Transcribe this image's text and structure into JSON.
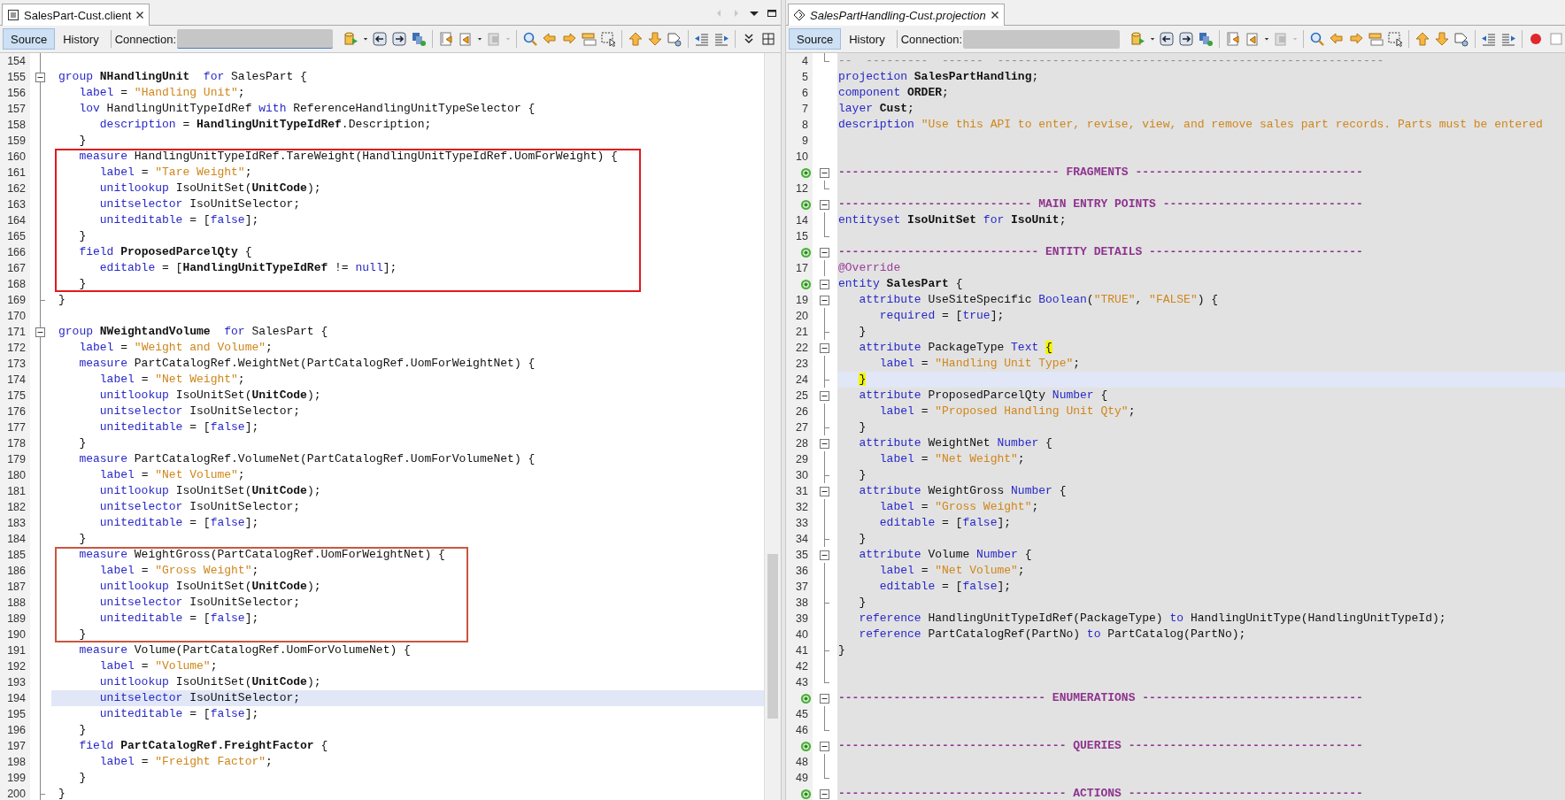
{
  "editors": [
    {
      "kind": "client",
      "tab": {
        "title": "SalesPart-Cust.client"
      },
      "toolbar": {
        "views": [
          {
            "label": "Source",
            "selected": true
          },
          {
            "label": "History",
            "selected": false
          }
        ],
        "connection_label": "Connection:"
      },
      "lines": [
        {
          "no": "154",
          "kind": "none",
          "current": false
        },
        {
          "no": "155",
          "kind": "open",
          "current": false,
          "code": [
            {
              "kind": "kw",
              "text": "group "
            },
            {
              "kind": "b",
              "text": "NHandlingUnit"
            },
            {
              "kind": "kw",
              "text": "  for"
            },
            {
              "kind": "p",
              "text": " SalesPart {"
            }
          ]
        },
        {
          "no": "156",
          "kind": "none",
          "current": false,
          "code": [
            {
              "kind": "kw",
              "text": "   label"
            },
            {
              "kind": "p",
              "text": " = "
            },
            {
              "kind": "str",
              "text": "\"Handling Unit\""
            },
            {
              "kind": "p",
              "text": ";"
            }
          ]
        },
        {
          "no": "157",
          "kind": "none",
          "current": false,
          "code": [
            {
              "kind": "kw",
              "text": "   lov"
            },
            {
              "kind": "p",
              "text": " HandlingUnitTypeIdRef "
            },
            {
              "kind": "kw",
              "text": "with"
            },
            {
              "kind": "p",
              "text": " ReferenceHandlingUnitTypeSelector {"
            }
          ]
        },
        {
          "no": "158",
          "kind": "none",
          "current": false,
          "code": [
            {
              "kind": "kw",
              "text": "      description"
            },
            {
              "kind": "p",
              "text": " = "
            },
            {
              "kind": "b",
              "text": "HandlingUnitTypeIdRef"
            },
            {
              "kind": "p",
              "text": ".Description;"
            }
          ]
        },
        {
          "no": "159",
          "kind": "none",
          "current": false,
          "code": [
            {
              "kind": "p",
              "text": "   }"
            }
          ]
        },
        {
          "kind": "box",
          "color": "#e01b1b",
          "lines": [
            {
              "no": "160",
              "current": false,
              "code": [
                {
                  "kind": "kw",
                  "text": "   measure"
                },
                {
                  "kind": "p",
                  "text": " HandlingUnitTypeIdRef.TareWeight(HandlingUnitTypeIdRef.UomForWeight) {"
                }
              ]
            },
            {
              "no": "161",
              "current": false,
              "code": [
                {
                  "kind": "kw",
                  "text": "      label"
                },
                {
                  "kind": "p",
                  "text": " = "
                },
                {
                  "kind": "str",
                  "text": "\"Tare Weight\""
                },
                {
                  "kind": "p",
                  "text": ";"
                }
              ]
            },
            {
              "no": "162",
              "current": false,
              "code": [
                {
                  "kind": "kw",
                  "text": "      unitlookup"
                },
                {
                  "kind": "p",
                  "text": " IsoUnitSet("
                },
                {
                  "kind": "b",
                  "text": "UnitCode"
                },
                {
                  "kind": "p",
                  "text": ");"
                }
              ]
            },
            {
              "no": "163",
              "current": false,
              "code": [
                {
                  "kind": "kw",
                  "text": "      unitselector"
                },
                {
                  "kind": "p",
                  "text": " IsoUnitSelector;"
                }
              ]
            },
            {
              "no": "164",
              "current": false,
              "code": [
                {
                  "kind": "kw",
                  "text": "      uniteditable"
                },
                {
                  "kind": "p",
                  "text": " = ["
                },
                {
                  "kind": "kw",
                  "text": "false"
                },
                {
                  "kind": "p",
                  "text": "];"
                }
              ]
            },
            {
              "no": "165",
              "current": false,
              "code": [
                {
                  "kind": "p",
                  "text": "   }"
                }
              ]
            },
            {
              "no": "166",
              "current": false,
              "code": [
                {
                  "kind": "kw",
                  "text": "   field"
                },
                {
                  "kind": "b",
                  "text": " ProposedParcelQty"
                },
                {
                  "kind": "p",
                  "text": " {"
                }
              ]
            },
            {
              "no": "167",
              "current": false,
              "code": [
                {
                  "kind": "kw",
                  "text": "      editable"
                },
                {
                  "kind": "p",
                  "text": " = ["
                },
                {
                  "kind": "b",
                  "text": "HandlingUnitTypeIdRef"
                },
                {
                  "kind": "p",
                  "text": " != "
                },
                {
                  "kind": "kw",
                  "text": "null"
                },
                {
                  "kind": "p",
                  "text": "];"
                }
              ]
            },
            {
              "no": "168",
              "current": false,
              "code": [
                {
                  "kind": "p",
                  "text": "   }"
                }
              ]
            }
          ]
        },
        {
          "no": "169",
          "kind": "end",
          "current": false,
          "code": [
            {
              "kind": "p",
              "text": "}"
            }
          ]
        },
        {
          "no": "170",
          "kind": "none",
          "current": false
        },
        {
          "no": "171",
          "kind": "open",
          "current": false,
          "code": [
            {
              "kind": "kw",
              "text": "group "
            },
            {
              "kind": "b",
              "text": "NWeightandVolume"
            },
            {
              "kind": "kw",
              "text": "  for"
            },
            {
              "kind": "p",
              "text": " SalesPart {"
            }
          ]
        },
        {
          "no": "172",
          "kind": "none",
          "current": false,
          "code": [
            {
              "kind": "kw",
              "text": "   label"
            },
            {
              "kind": "p",
              "text": " = "
            },
            {
              "kind": "str",
              "text": "\"Weight and Volume\""
            },
            {
              "kind": "p",
              "text": ";"
            }
          ]
        },
        {
          "no": "173",
          "kind": "none",
          "current": false,
          "code": [
            {
              "kind": "kw",
              "text": "   measure"
            },
            {
              "kind": "p",
              "text": " PartCatalogRef.WeightNet(PartCatalogRef.UomForWeightNet) {"
            }
          ]
        },
        {
          "no": "174",
          "kind": "none",
          "current": false,
          "code": [
            {
              "kind": "kw",
              "text": "      label"
            },
            {
              "kind": "p",
              "text": " = "
            },
            {
              "kind": "str",
              "text": "\"Net Weight\""
            },
            {
              "kind": "p",
              "text": ";"
            }
          ]
        },
        {
          "no": "175",
          "kind": "none",
          "current": false,
          "code": [
            {
              "kind": "kw",
              "text": "      unitlookup"
            },
            {
              "kind": "p",
              "text": " IsoUnitSet("
            },
            {
              "kind": "b",
              "text": "UnitCode"
            },
            {
              "kind": "p",
              "text": ");"
            }
          ]
        },
        {
          "no": "176",
          "kind": "none",
          "current": false,
          "code": [
            {
              "kind": "kw",
              "text": "      unitselector"
            },
            {
              "kind": "p",
              "text": " IsoUnitSelector;"
            }
          ]
        },
        {
          "no": "177",
          "kind": "none",
          "current": false,
          "code": [
            {
              "kind": "kw",
              "text": "      uniteditable"
            },
            {
              "kind": "p",
              "text": " = ["
            },
            {
              "kind": "kw",
              "text": "false"
            },
            {
              "kind": "p",
              "text": "];"
            }
          ]
        },
        {
          "no": "178",
          "kind": "none",
          "current": false,
          "code": [
            {
              "kind": "p",
              "text": "   }"
            }
          ]
        },
        {
          "no": "179",
          "kind": "none",
          "current": false,
          "code": [
            {
              "kind": "kw",
              "text": "   measure"
            },
            {
              "kind": "p",
              "text": " PartCatalogRef.VolumeNet(PartCatalogRef.UomForVolumeNet) {"
            }
          ]
        },
        {
          "no": "180",
          "kind": "none",
          "current": false,
          "code": [
            {
              "kind": "kw",
              "text": "      label"
            },
            {
              "kind": "p",
              "text": " = "
            },
            {
              "kind": "str",
              "text": "\"Net Volume\""
            },
            {
              "kind": "p",
              "text": ";"
            }
          ]
        },
        {
          "no": "181",
          "kind": "none",
          "current": false,
          "code": [
            {
              "kind": "kw",
              "text": "      unitlookup"
            },
            {
              "kind": "p",
              "text": " IsoUnitSet("
            },
            {
              "kind": "b",
              "text": "UnitCode"
            },
            {
              "kind": "p",
              "text": ");"
            }
          ]
        },
        {
          "no": "182",
          "kind": "none",
          "current": false,
          "code": [
            {
              "kind": "kw",
              "text": "      unitselector"
            },
            {
              "kind": "p",
              "text": " IsoUnitSelector;"
            }
          ]
        },
        {
          "no": "183",
          "kind": "none",
          "current": false,
          "code": [
            {
              "kind": "kw",
              "text": "      uniteditable"
            },
            {
              "kind": "p",
              "text": " = ["
            },
            {
              "kind": "kw",
              "text": "false"
            },
            {
              "kind": "p",
              "text": "];"
            }
          ]
        },
        {
          "no": "184",
          "kind": "none",
          "current": false,
          "code": [
            {
              "kind": "p",
              "text": "   }"
            }
          ]
        },
        {
          "kind": "box",
          "color": "#c9573f",
          "lines": [
            {
              "no": "185",
              "current": false,
              "code": [
                {
                  "kind": "kw",
                  "text": "   measure"
                },
                {
                  "kind": "p",
                  "text": " WeightGross(PartCatalogRef.UomForWeightNet) {"
                }
              ]
            },
            {
              "no": "186",
              "current": false,
              "code": [
                {
                  "kind": "kw",
                  "text": "      label"
                },
                {
                  "kind": "p",
                  "text": " = "
                },
                {
                  "kind": "str",
                  "text": "\"Gross Weight\""
                },
                {
                  "kind": "p",
                  "text": ";"
                }
              ]
            },
            {
              "no": "187",
              "current": false,
              "code": [
                {
                  "kind": "kw",
                  "text": "      unitlookup"
                },
                {
                  "kind": "p",
                  "text": " IsoUnitSet("
                },
                {
                  "kind": "b",
                  "text": "UnitCode"
                },
                {
                  "kind": "p",
                  "text": ");"
                }
              ]
            },
            {
              "no": "188",
              "current": false,
              "code": [
                {
                  "kind": "kw",
                  "text": "      unitselector"
                },
                {
                  "kind": "p",
                  "text": " IsoUnitSelector;"
                }
              ]
            },
            {
              "no": "189",
              "current": false,
              "code": [
                {
                  "kind": "kw",
                  "text": "      uniteditable"
                },
                {
                  "kind": "p",
                  "text": " = ["
                },
                {
                  "kind": "kw",
                  "text": "false"
                },
                {
                  "kind": "p",
                  "text": "];"
                }
              ]
            },
            {
              "no": "190",
              "current": false,
              "code": [
                {
                  "kind": "p",
                  "text": "   }"
                }
              ]
            }
          ]
        },
        {
          "no": "191",
          "kind": "none",
          "current": false,
          "code": [
            {
              "kind": "kw",
              "text": "   measure"
            },
            {
              "kind": "p",
              "text": " Volume(PartCatalogRef.UomForVolumeNet) {"
            }
          ]
        },
        {
          "no": "192",
          "kind": "none",
          "current": false,
          "code": [
            {
              "kind": "kw",
              "text": "      label"
            },
            {
              "kind": "p",
              "text": " = "
            },
            {
              "kind": "str",
              "text": "\"Volume\""
            },
            {
              "kind": "p",
              "text": ";"
            }
          ]
        },
        {
          "no": "193",
          "kind": "none",
          "current": false,
          "code": [
            {
              "kind": "kw",
              "text": "      unitlookup"
            },
            {
              "kind": "p",
              "text": " IsoUnitSet("
            },
            {
              "kind": "b",
              "text": "UnitCode"
            },
            {
              "kind": "p",
              "text": ");"
            }
          ]
        },
        {
          "no": "194",
          "kind": "none",
          "current": true,
          "code": [
            {
              "kind": "kw",
              "text": "      unitselector"
            },
            {
              "kind": "p",
              "text": " IsoUnitSelector;"
            }
          ]
        },
        {
          "no": "195",
          "kind": "none",
          "current": false,
          "code": [
            {
              "kind": "kw",
              "text": "      uniteditable"
            },
            {
              "kind": "p",
              "text": " = ["
            },
            {
              "kind": "kw",
              "text": "false"
            },
            {
              "kind": "p",
              "text": "];"
            }
          ]
        },
        {
          "no": "196",
          "kind": "none",
          "current": false,
          "code": [
            {
              "kind": "p",
              "text": "   }"
            }
          ]
        },
        {
          "no": "197",
          "kind": "none",
          "current": false,
          "code": [
            {
              "kind": "kw",
              "text": "   field"
            },
            {
              "kind": "b",
              "text": " PartCatalogRef.FreightFactor"
            },
            {
              "kind": "p",
              "text": " {"
            }
          ]
        },
        {
          "no": "198",
          "kind": "none",
          "current": false,
          "code": [
            {
              "kind": "kw",
              "text": "      label"
            },
            {
              "kind": "p",
              "text": " = "
            },
            {
              "kind": "str",
              "text": "\"Freight Factor\""
            },
            {
              "kind": "p",
              "text": ";"
            }
          ]
        },
        {
          "no": "199",
          "kind": "none",
          "current": false,
          "code": [
            {
              "kind": "p",
              "text": "   }"
            }
          ]
        },
        {
          "no": "200",
          "kind": "end",
          "current": false,
          "code": [
            {
              "kind": "p",
              "text": "}"
            }
          ]
        }
      ]
    },
    {
      "kind": "projection",
      "tab": {
        "title": "SalesPartHandling-Cust.projection"
      },
      "toolbar": {
        "views": [
          {
            "label": "Source",
            "selected": true
          },
          {
            "label": "History",
            "selected": false
          }
        ],
        "connection_label": "Connection:"
      },
      "lines": [
        {
          "no": "4",
          "kind": "end",
          "current": false,
          "marked": false,
          "code": [
            {
              "kind": "cm",
              "text": "--  ---------  ------  --------------------------------------------------------"
            }
          ]
        },
        {
          "no": "5",
          "kind": "none",
          "current": false,
          "marked": false,
          "code": [
            {
              "kind": "kw",
              "text": "projection"
            },
            {
              "kind": "b",
              "text": " SalesPartHandling"
            },
            {
              "kind": "p",
              "text": ";"
            }
          ]
        },
        {
          "no": "6",
          "kind": "none",
          "current": false,
          "marked": false,
          "code": [
            {
              "kind": "kw",
              "text": "component"
            },
            {
              "kind": "b",
              "text": " ORDER"
            },
            {
              "kind": "p",
              "text": ";"
            }
          ]
        },
        {
          "no": "7",
          "kind": "none",
          "current": false,
          "marked": false,
          "code": [
            {
              "kind": "kw",
              "text": "layer"
            },
            {
              "kind": "b",
              "text": " Cust"
            },
            {
              "kind": "p",
              "text": ";"
            }
          ]
        },
        {
          "no": "8",
          "kind": "none",
          "current": false,
          "marked": false,
          "code": [
            {
              "kind": "kw",
              "text": "description"
            },
            {
              "kind": "str",
              "text": " \"Use this API to enter, revise, view, and remove sales part records. Parts must be entered"
            }
          ]
        },
        {
          "no": "9",
          "kind": "none",
          "current": false,
          "marked": false
        },
        {
          "no": "10",
          "kind": "none",
          "current": false,
          "marked": false
        },
        {
          "kind": "open",
          "current": false,
          "marked": true,
          "code": [
            {
              "kind": "sec",
              "text": "-------------------------------- FRAGMENTS ---------------------------------"
            }
          ]
        },
        {
          "no": "12",
          "kind": "end",
          "current": false,
          "marked": false
        },
        {
          "kind": "open",
          "current": false,
          "marked": true,
          "code": [
            {
              "kind": "sec",
              "text": "---------------------------- MAIN ENTRY POINTS -----------------------------"
            }
          ]
        },
        {
          "no": "14",
          "kind": "line",
          "current": false,
          "marked": false,
          "code": [
            {
              "kind": "kw",
              "text": "entityset"
            },
            {
              "kind": "b",
              "text": " IsoUnitSet"
            },
            {
              "kind": "kw",
              "text": " for"
            },
            {
              "kind": "b",
              "text": " IsoUnit"
            },
            {
              "kind": "p",
              "text": ";"
            }
          ]
        },
        {
          "no": "15",
          "kind": "end",
          "current": false,
          "marked": false
        },
        {
          "kind": "open",
          "current": false,
          "marked": true,
          "code": [
            {
              "kind": "sec",
              "text": "----------------------------- ENTITY DETAILS -------------------------------"
            }
          ]
        },
        {
          "no": "17",
          "kind": "line",
          "current": false,
          "marked": false,
          "code": [
            {
              "kind": "ann",
              "text": "@Override"
            }
          ]
        },
        {
          "kind": "open",
          "current": false,
          "marked": true,
          "code": [
            {
              "kind": "kw",
              "text": "entity"
            },
            {
              "kind": "b",
              "text": " SalesPart"
            },
            {
              "kind": "p",
              "text": " {"
            }
          ]
        },
        {
          "no": "19",
          "kind": "open",
          "current": false,
          "marked": false,
          "code": [
            {
              "kind": "kw",
              "text": "   attribute"
            },
            {
              "kind": "p",
              "text": " UseSiteSpecific "
            },
            {
              "kind": "kw",
              "text": "Boolean"
            },
            {
              "kind": "p",
              "text": "("
            },
            {
              "kind": "str",
              "text": "\"TRUE\""
            },
            {
              "kind": "p",
              "text": ", "
            },
            {
              "kind": "str",
              "text": "\"FALSE\""
            },
            {
              "kind": "p",
              "text": ") {"
            }
          ]
        },
        {
          "no": "20",
          "kind": "line",
          "current": false,
          "marked": false,
          "code": [
            {
              "kind": "kw",
              "text": "      required"
            },
            {
              "kind": "p",
              "text": " = ["
            },
            {
              "kind": "kw",
              "text": "true"
            },
            {
              "kind": "p",
              "text": "];"
            }
          ]
        },
        {
          "no": "21",
          "kind": "mid",
          "current": false,
          "marked": false,
          "code": [
            {
              "kind": "p",
              "text": "   }"
            }
          ]
        },
        {
          "no": "22",
          "kind": "open",
          "current": false,
          "marked": false,
          "code": [
            {
              "kind": "kw",
              "text": "   attribute"
            },
            {
              "kind": "p",
              "text": " PackageType "
            },
            {
              "kind": "kw",
              "text": "Text"
            },
            {
              "kind": "match",
              "text": "{"
            }
          ]
        },
        {
          "no": "23",
          "kind": "line",
          "current": false,
          "marked": false,
          "code": [
            {
              "kind": "kw",
              "text": "      label"
            },
            {
              "kind": "p",
              "text": " = "
            },
            {
              "kind": "str",
              "text": "\"Handling Unit Type\""
            },
            {
              "kind": "p",
              "text": ";"
            }
          ]
        },
        {
          "no": "24",
          "kind": "mid",
          "current": true,
          "marked": false,
          "code": [
            {
              "kind": "match",
              "text": "}"
            }
          ]
        },
        {
          "no": "25",
          "kind": "open",
          "current": false,
          "marked": false,
          "code": [
            {
              "kind": "kw",
              "text": "   attribute"
            },
            {
              "kind": "p",
              "text": " ProposedParcelQty "
            },
            {
              "kind": "kw",
              "text": "Number"
            },
            {
              "kind": "p",
              "text": " {"
            }
          ]
        },
        {
          "no": "26",
          "kind": "line",
          "current": false,
          "marked": false,
          "code": [
            {
              "kind": "kw",
              "text": "      label"
            },
            {
              "kind": "p",
              "text": " = "
            },
            {
              "kind": "str",
              "text": "\"Proposed Handling Unit Qty\""
            },
            {
              "kind": "p",
              "text": ";"
            }
          ]
        },
        {
          "no": "27",
          "kind": "mid",
          "current": false,
          "marked": false,
          "code": [
            {
              "kind": "p",
              "text": "   }"
            }
          ]
        },
        {
          "no": "28",
          "kind": "open",
          "current": false,
          "marked": false,
          "code": [
            {
              "kind": "kw",
              "text": "   attribute"
            },
            {
              "kind": "p",
              "text": " WeightNet "
            },
            {
              "kind": "kw",
              "text": "Number"
            },
            {
              "kind": "p",
              "text": " {"
            }
          ]
        },
        {
          "no": "29",
          "kind": "line",
          "current": false,
          "marked": false,
          "code": [
            {
              "kind": "kw",
              "text": "      label"
            },
            {
              "kind": "p",
              "text": " = "
            },
            {
              "kind": "str",
              "text": "\"Net Weight\""
            },
            {
              "kind": "p",
              "text": ";"
            }
          ]
        },
        {
          "no": "30",
          "kind": "mid",
          "current": false,
          "marked": false,
          "code": [
            {
              "kind": "p",
              "text": "   }"
            }
          ]
        },
        {
          "no": "31",
          "kind": "open",
          "current": false,
          "marked": false,
          "code": [
            {
              "kind": "kw",
              "text": "   attribute"
            },
            {
              "kind": "p",
              "text": " WeightGross "
            },
            {
              "kind": "kw",
              "text": "Number"
            },
            {
              "kind": "p",
              "text": " {"
            }
          ]
        },
        {
          "no": "32",
          "kind": "line",
          "current": false,
          "marked": false,
          "code": [
            {
              "kind": "kw",
              "text": "      label"
            },
            {
              "kind": "p",
              "text": " = "
            },
            {
              "kind": "str",
              "text": "\"Gross Weight\""
            },
            {
              "kind": "p",
              "text": ";"
            }
          ]
        },
        {
          "no": "33",
          "kind": "line",
          "current": false,
          "marked": false,
          "code": [
            {
              "kind": "kw",
              "text": "      editable"
            },
            {
              "kind": "p",
              "text": " = ["
            },
            {
              "kind": "kw",
              "text": "false"
            },
            {
              "kind": "p",
              "text": "];"
            }
          ]
        },
        {
          "no": "34",
          "kind": "mid",
          "current": false,
          "marked": false,
          "code": [
            {
              "kind": "p",
              "text": "   }"
            }
          ]
        },
        {
          "no": "35",
          "kind": "open",
          "current": false,
          "marked": false,
          "code": [
            {
              "kind": "kw",
              "text": "   attribute"
            },
            {
              "kind": "p",
              "text": " Volume "
            },
            {
              "kind": "kw",
              "text": "Number"
            },
            {
              "kind": "p",
              "text": " {"
            }
          ]
        },
        {
          "no": "36",
          "kind": "line",
          "current": false,
          "marked": false,
          "code": [
            {
              "kind": "kw",
              "text": "      label"
            },
            {
              "kind": "p",
              "text": " = "
            },
            {
              "kind": "str",
              "text": "\"Net Volume\""
            },
            {
              "kind": "p",
              "text": ";"
            }
          ]
        },
        {
          "no": "37",
          "kind": "line",
          "current": false,
          "marked": false,
          "code": [
            {
              "kind": "kw",
              "text": "      editable"
            },
            {
              "kind": "p",
              "text": " = ["
            },
            {
              "kind": "kw",
              "text": "false"
            },
            {
              "kind": "p",
              "text": "];"
            }
          ]
        },
        {
          "no": "38",
          "kind": "mid",
          "current": false,
          "marked": false,
          "code": [
            {
              "kind": "p",
              "text": "   }"
            }
          ]
        },
        {
          "no": "39",
          "kind": "line",
          "current": false,
          "marked": false,
          "code": [
            {
              "kind": "kw",
              "text": "   reference"
            },
            {
              "kind": "p",
              "text": " HandlingUnitTypeIdRef(PackageType) "
            },
            {
              "kind": "kw",
              "text": "to"
            },
            {
              "kind": "p",
              "text": " HandlingUnitType(HandlingUnitTypeId);"
            }
          ]
        },
        {
          "no": "40",
          "kind": "line",
          "current": false,
          "marked": false,
          "code": [
            {
              "kind": "kw",
              "text": "   reference"
            },
            {
              "kind": "p",
              "text": " PartCatalogRef(PartNo) "
            },
            {
              "kind": "kw",
              "text": "to"
            },
            {
              "kind": "p",
              "text": " PartCatalog(PartNo);"
            }
          ]
        },
        {
          "no": "41",
          "kind": "mid",
          "current": false,
          "marked": false,
          "code": [
            {
              "kind": "p",
              "text": "}"
            }
          ]
        },
        {
          "no": "42",
          "kind": "line",
          "current": false,
          "marked": false
        },
        {
          "no": "43",
          "kind": "end",
          "current": false,
          "marked": false
        },
        {
          "kind": "open",
          "current": false,
          "marked": true,
          "code": [
            {
              "kind": "sec",
              "text": "------------------------------ ENUMERATIONS --------------------------------"
            }
          ]
        },
        {
          "no": "45",
          "kind": "line",
          "current": false,
          "marked": false
        },
        {
          "no": "46",
          "kind": "end",
          "current": false,
          "marked": false
        },
        {
          "kind": "open",
          "current": false,
          "marked": true,
          "code": [
            {
              "kind": "sec",
              "text": "--------------------------------- QUERIES ----------------------------------"
            }
          ]
        },
        {
          "no": "48",
          "kind": "line",
          "current": false,
          "marked": false
        },
        {
          "no": "49",
          "kind": "end",
          "current": false,
          "marked": false
        },
        {
          "kind": "open",
          "current": false,
          "marked": true,
          "code": [
            {
              "kind": "sec",
              "text": "--------------------------------- ACTIONS ----------------------------------"
            }
          ]
        }
      ]
    }
  ]
}
